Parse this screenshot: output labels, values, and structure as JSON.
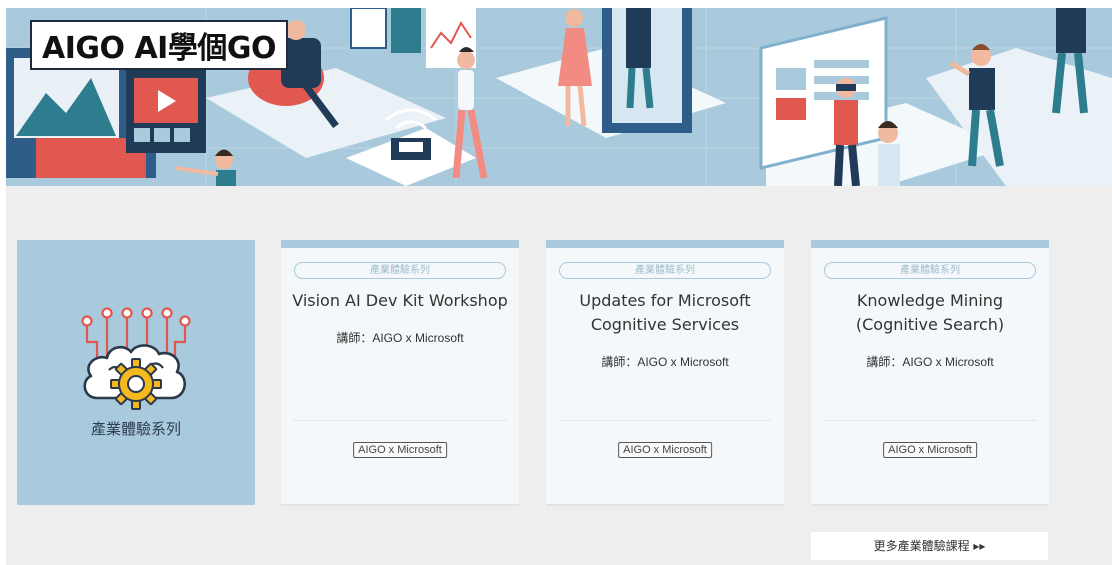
{
  "banner": {
    "logo_text": "AIGO AI學個GO"
  },
  "series_card": {
    "title": "產業體驗系列",
    "icon": "brain-gear-icon"
  },
  "courses": [
    {
      "tag": "產業體驗系列",
      "title_line1": "Vision AI Dev Kit Workshop",
      "title_line2": "",
      "instructor": "講師：AIGO x Microsoft",
      "pill": "AIGO x Microsoft"
    },
    {
      "tag": "產業體驗系列",
      "title_line1": "Updates for Microsoft",
      "title_line2": "Cognitive Services",
      "instructor": "講師：AIGO x Microsoft",
      "pill": "AIGO x Microsoft"
    },
    {
      "tag": "產業體驗系列",
      "title_line1": "Knowledge Mining",
      "title_line2": "(Cognitive Search)",
      "instructor": "講師：AIGO x Microsoft",
      "pill": "AIGO x Microsoft"
    }
  ],
  "more_link": {
    "label": "更多產業體驗課程 ▸▸"
  },
  "colors": {
    "accent": "#a9c9dc",
    "card_bg": "#f5f8fa",
    "page_bg": "#eeeeee",
    "icon_red": "#e0584f",
    "icon_gear": "#f5b91f",
    "icon_dark": "#2b3a4a"
  }
}
